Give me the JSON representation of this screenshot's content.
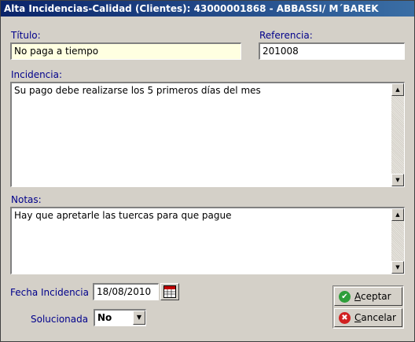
{
  "window": {
    "title": "Alta Incidencias-Calidad (Clientes): 43000001868 - ABBASSI/ M´BAREK"
  },
  "form": {
    "titulo_label": "Título:",
    "titulo_value": "No paga a tiempo",
    "referencia_label": "Referencia:",
    "referencia_value": "201008",
    "incidencia_label": "Incidencia:",
    "incidencia_value": "Su pago debe realizarse los 5 primeros días del mes",
    "notas_label": "Notas:",
    "notas_value": "Hay que apretarle las tuercas para que pague",
    "fecha_label": "Fecha Incidencia",
    "fecha_value": "18/08/2010",
    "solucionada_label": "Solucionada",
    "solucionada_value": "No"
  },
  "buttons": {
    "aceptar": "Aceptar",
    "cancelar": "Cancelar"
  },
  "icons": {
    "calendar": "calendar-icon",
    "ok": "check-icon",
    "cancel": "x-icon"
  },
  "colors": {
    "title_bar": "#0a246a",
    "label": "#00008b",
    "field_highlight": "#ffffe1"
  }
}
